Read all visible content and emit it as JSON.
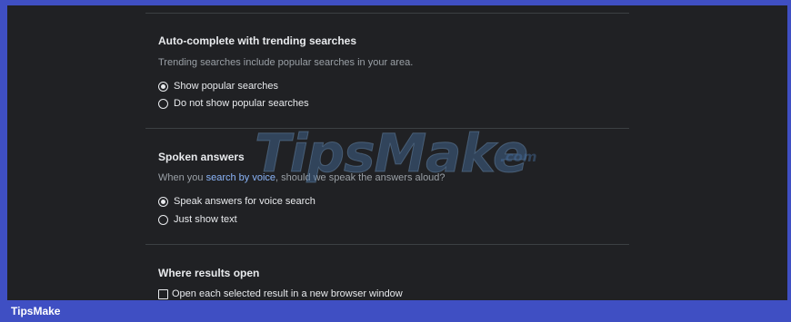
{
  "sections": {
    "autocomplete": {
      "title": "Auto-complete with trending searches",
      "description": "Trending searches include popular searches in your area.",
      "options": [
        {
          "label": "Show popular searches",
          "checked": true
        },
        {
          "label": "Do not show popular searches",
          "checked": false
        }
      ]
    },
    "spoken": {
      "title": "Spoken answers",
      "description_before": "When you ",
      "description_link": "search by voice",
      "description_after": ", should we speak the answers aloud?",
      "options": [
        {
          "label": "Speak answers for voice search",
          "checked": true
        },
        {
          "label": "Just show text",
          "checked": false
        }
      ]
    },
    "results": {
      "title": "Where results open",
      "options": [
        {
          "label": "Open each selected result in a new browser window",
          "checked": false
        }
      ]
    }
  },
  "watermark": {
    "text": "TipsMake",
    "suffix": ".com"
  },
  "footer": {
    "brand": "TipsMake"
  },
  "colors": {
    "background": "#202124",
    "accent_frame": "#3f4fc3",
    "link": "#8ab4f8",
    "text_primary": "#e8eaed",
    "text_secondary": "#9aa0a6"
  }
}
